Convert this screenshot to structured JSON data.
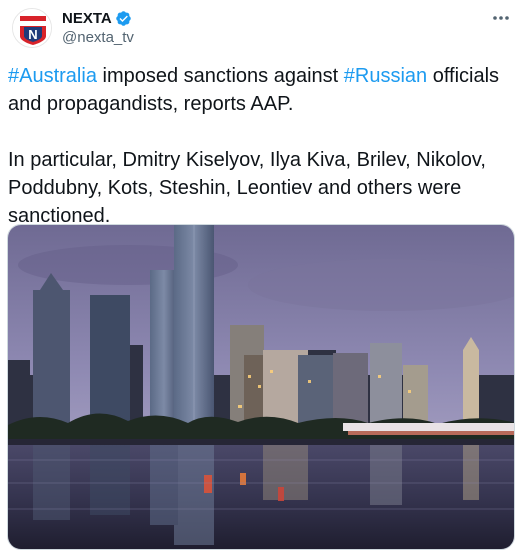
{
  "tweet": {
    "author": {
      "display_name": "NEXTA",
      "handle": "@nexta_tv",
      "verified": true,
      "avatar_letter": "N",
      "avatar_icon": "nexta-logo-icon"
    },
    "more_icon": "more-horizontal-icon",
    "paragraph1": {
      "hashtag1": "#Australia",
      "text1": " imposed sanctions against ",
      "hashtag2": "#Russian",
      "text2": " officials and propagandists, reports AAP."
    },
    "paragraph2": "In particular, Dmitry Kiselyov, Ilya Kiva, Brilev, Nikolov, Poddubny, Kots, Steshin, Leontiev and others were sanctioned.",
    "media": {
      "kind": "photo",
      "subject": "city-skyline-at-dusk-over-river"
    }
  },
  "colors": {
    "text": "#0f1419",
    "secondary": "#536471",
    "link": "#1d9bf0",
    "verified": "#1d9bf0",
    "brand_red": "#d8232a",
    "brand_blue": "#1f3a7a"
  }
}
